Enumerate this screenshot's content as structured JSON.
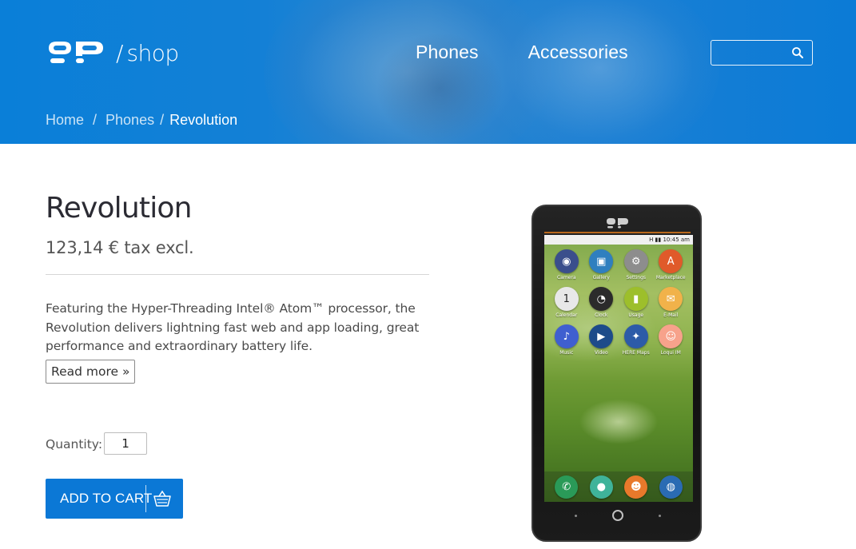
{
  "header": {
    "logo_text": "shop",
    "logo_slash": "/",
    "nav": [
      {
        "label": "Phones"
      },
      {
        "label": "Accessories"
      }
    ],
    "search": {
      "placeholder": "",
      "value": ""
    }
  },
  "breadcrumb": {
    "items": [
      "Home",
      "Phones",
      "Revolution"
    ],
    "separator": "/"
  },
  "product": {
    "title": "Revolution",
    "price": "123,14 € tax excl.",
    "description": "Featuring the Hyper-Threading Intel® Atom™ processor, the Revolution delivers lightning fast web and app loading, great performance and extraordinary battery life.",
    "read_more": "Read more »",
    "quantity_label": "Quantity:",
    "quantity_value": "1",
    "add_to_cart": "ADD TO CART"
  },
  "phone": {
    "status_text": "H  ▮▮  10:45 am",
    "apps": [
      {
        "label": "Camera",
        "color": "#3a4e8c",
        "icon": "camera-icon"
      },
      {
        "label": "Gallery",
        "color": "#2f7fbf",
        "icon": "gallery-icon"
      },
      {
        "label": "Settings",
        "color": "#8d8d8d",
        "icon": "settings-icon"
      },
      {
        "label": "Marketplace",
        "color": "#e05a2a",
        "icon": "marketplace-icon"
      },
      {
        "label": "Calendar",
        "color": "#e8e8e8",
        "icon": "calendar-icon"
      },
      {
        "label": "Clock",
        "color": "#2b2b2b",
        "icon": "clock-icon"
      },
      {
        "label": "Usage",
        "color": "#9dbf2b",
        "icon": "usage-icon"
      },
      {
        "label": "E-Mail",
        "color": "#f1b24a",
        "icon": "email-icon"
      },
      {
        "label": "Music",
        "color": "#3f5fd0",
        "icon": "music-icon"
      },
      {
        "label": "Video",
        "color": "#1d4b8a",
        "icon": "video-icon"
      },
      {
        "label": "HERE Maps",
        "color": "#2c5ba8",
        "icon": "maps-icon"
      },
      {
        "label": "Loqui IM",
        "color": "#f7a28b",
        "icon": "loqui-icon"
      }
    ],
    "dock": [
      {
        "color": "#2a9a58",
        "icon": "phone-call-icon"
      },
      {
        "color": "#3fb39a",
        "icon": "messages-icon"
      },
      {
        "color": "#e8792b",
        "icon": "contacts-icon"
      },
      {
        "color": "#2a6bb3",
        "icon": "browser-icon"
      }
    ]
  }
}
